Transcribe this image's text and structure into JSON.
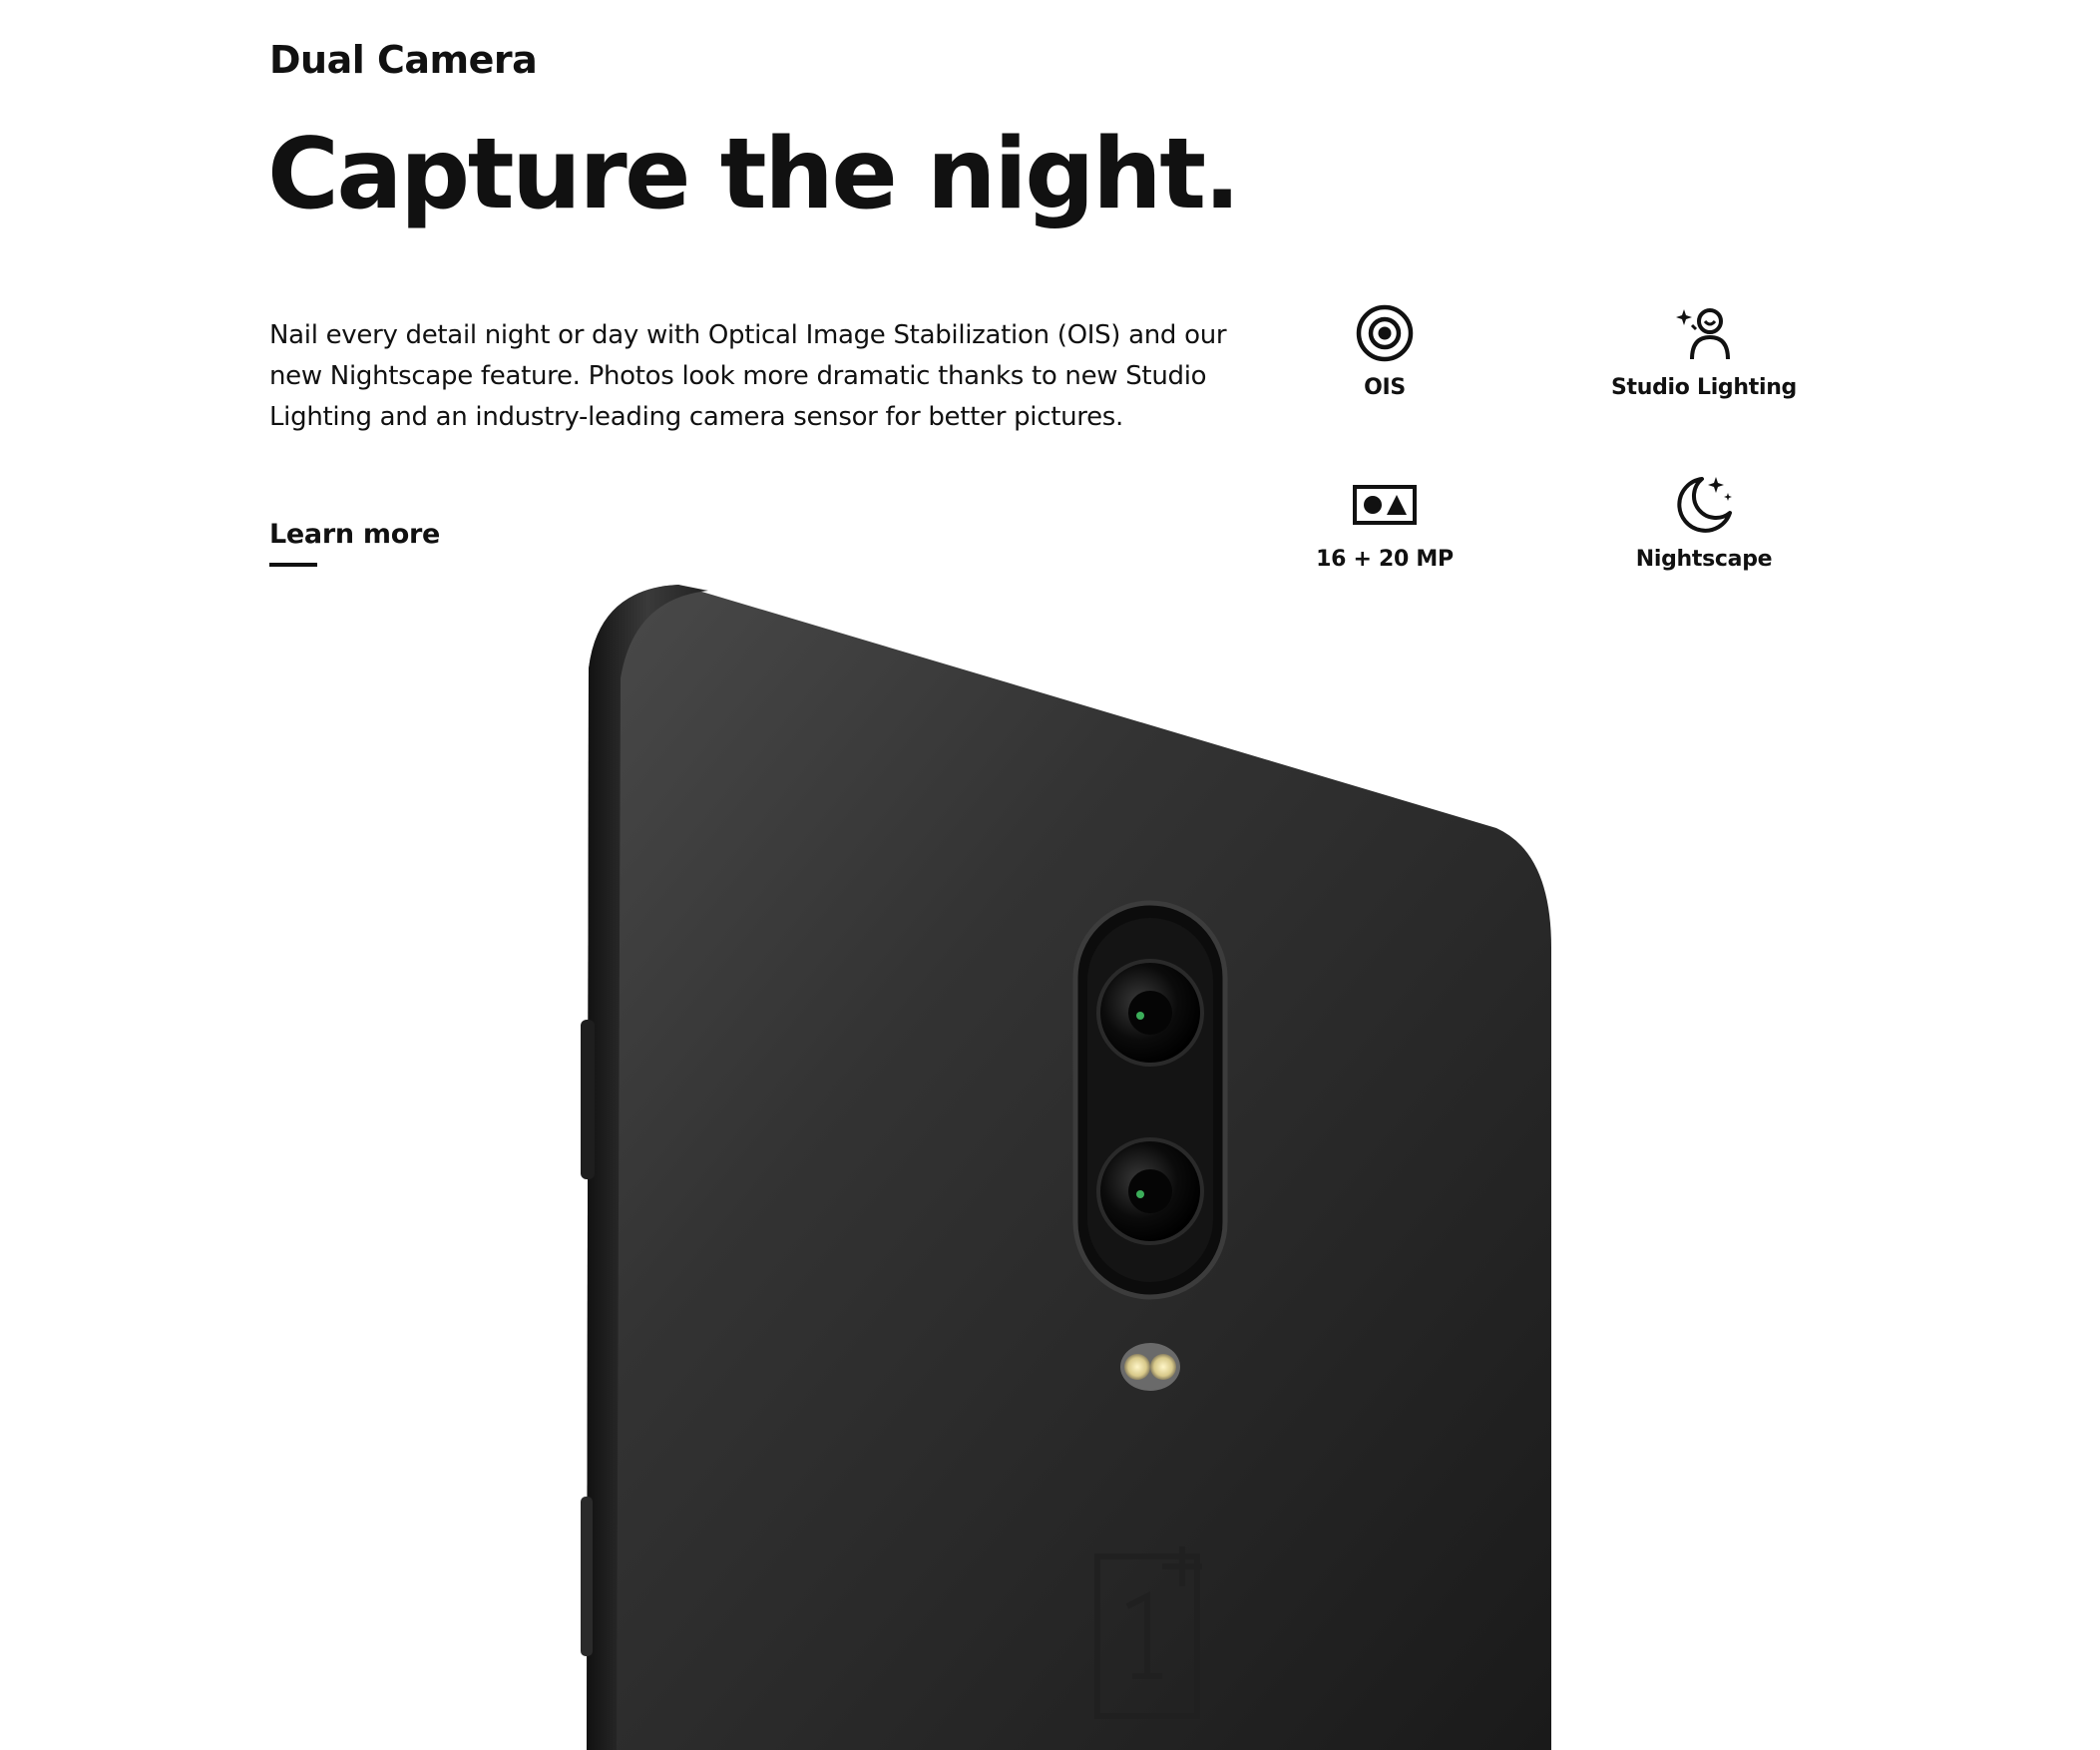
{
  "section": {
    "eyebrow": "Dual Camera",
    "headline": "Capture the night.",
    "description": "Nail every detail night or day with Optical Image Stabilization (OIS) and our new Nightscape feature. Photos look more dramatic thanks to new Studio Lighting and an industry-leading camera sensor for better pictures.",
    "learn_more_label": "Learn more"
  },
  "features": [
    {
      "label": "OIS",
      "icon": "ois-icon"
    },
    {
      "label": "Studio Lighting",
      "icon": "studio-lighting-icon"
    },
    {
      "label": "16 + 20 MP",
      "icon": "dual-lens-icon"
    },
    {
      "label": "Nightscape",
      "icon": "moon-stars-icon"
    }
  ],
  "product_image": {
    "icon": "phone-back-image"
  },
  "colors": {
    "text": "#111111",
    "background": "#ffffff",
    "phone_body": "#2b2b2b"
  }
}
